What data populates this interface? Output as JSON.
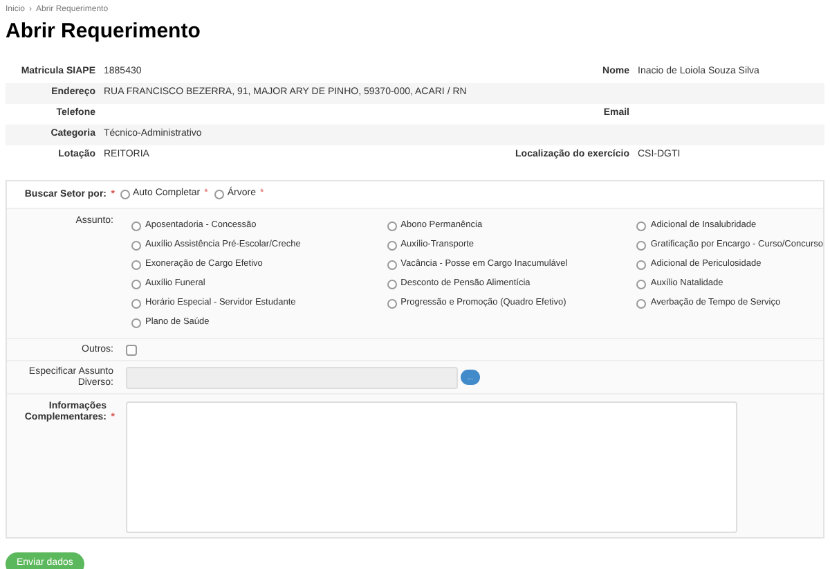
{
  "breadcrumb": [
    {
      "label": "Inicio"
    },
    {
      "label": "›"
    },
    {
      "label": "Abrir Requerimento"
    }
  ],
  "title": "Abrir Requerimento",
  "info": [
    {
      "left_label": "Matricula SIAPE",
      "left_value": "1885430",
      "right_label": "Nome",
      "right_value": "Inacio de Loiola Souza Silva"
    },
    {
      "left_label": "Endereço",
      "left_value": "RUA FRANCISCO BEZERRA, 91, MAJOR ARY DE PINHO, 59370-000, ACARI / RN"
    },
    {
      "left_label": "Telefone",
      "right_label": "Email"
    },
    {
      "left_label": "Categoria",
      "left_value": "Técnico-Administrativo"
    },
    {
      "left_label": "Lotação",
      "left_value": "REITORIA",
      "right_label": "Localização do exercício",
      "right_value": "CSI-DGTI"
    }
  ],
  "buscar": {
    "label": "Buscar Setor por:",
    "required_mark": "*",
    "options": [
      {
        "label": "Auto Completar",
        "required_mark": "*",
        "selected": false
      },
      {
        "label": "Árvore",
        "required_mark": "*",
        "selected": false
      }
    ]
  },
  "assunto": {
    "label": "Assunto:",
    "columns": [
      [
        {
          "label": "Aposentadoria - Concessão",
          "selected": false
        },
        {
          "label": "Auxílio Assistência Pré-Escolar/Creche",
          "selected": false
        },
        {
          "label": "Exoneração de Cargo Efetivo",
          "selected": false
        },
        {
          "label": "Auxílio Funeral",
          "selected": false
        },
        {
          "label": "Horário Especial - Servidor Estudante",
          "selected": false
        },
        {
          "label": "Plano de Saúde",
          "selected": false
        }
      ],
      [
        {
          "label": "Abono Permanência",
          "selected": false
        },
        {
          "label": "Auxílio-Transporte",
          "selected": false
        },
        {
          "label": "Vacância - Posse em Cargo Inacumulável",
          "selected": false
        },
        {
          "label": "Desconto de Pensão Alimentícia",
          "selected": false
        },
        {
          "label": "Progressão e Promoção (Quadro Efetivo)",
          "selected": false
        }
      ],
      [
        {
          "label": "Adicional de Insalubridade",
          "selected": false
        },
        {
          "label": "Gratificação por Encargo - Curso/Concurso",
          "selected": false
        },
        {
          "label": "Adicional de Periculosidade",
          "selected": false
        },
        {
          "label": "Auxílio Natalidade",
          "selected": false
        },
        {
          "label": "Averbação de Tempo de Serviço",
          "selected": false
        }
      ]
    ]
  },
  "outros": {
    "label": "Outros:",
    "checked": false
  },
  "especificar": {
    "label": "Especificar Assunto Diverso:",
    "disabled": true,
    "button": "..."
  },
  "informacoes": {
    "label": "Informações Complementares:",
    "required_mark": "*"
  },
  "submit": "Enviar dados"
}
